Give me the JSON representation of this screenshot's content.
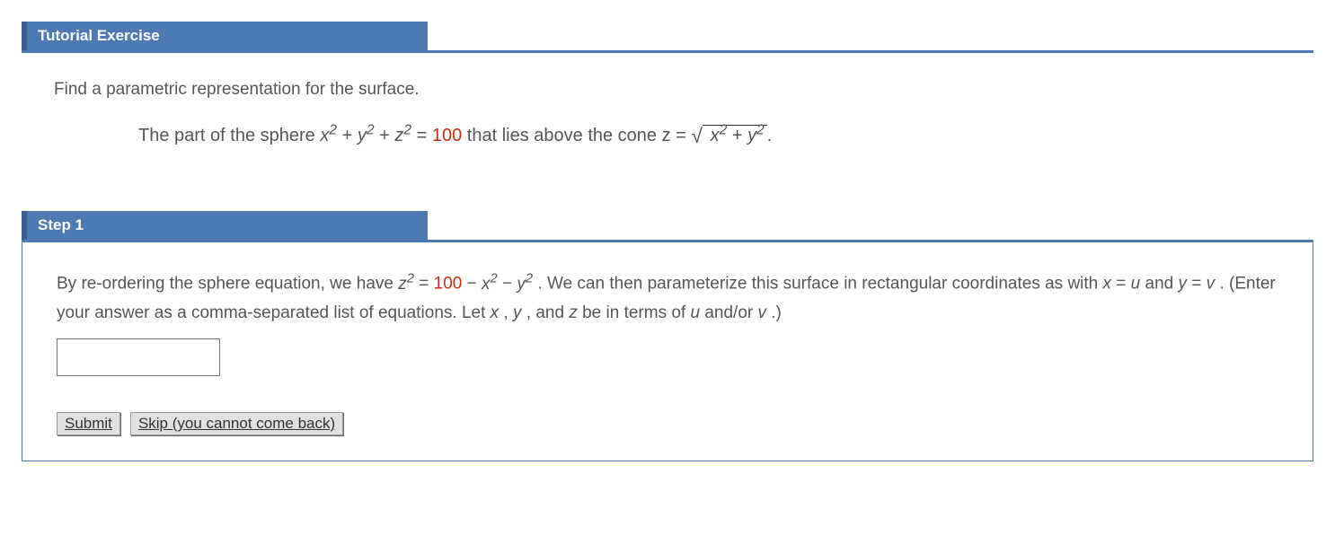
{
  "tutorial": {
    "header": "Tutorial Exercise",
    "intro": "Find a parametric representation for the surface.",
    "problem_prefix": "The part of the sphere ",
    "sphere_expr_a": "x",
    "sphere_expr_plus": " + ",
    "sphere_expr_b": "y",
    "sphere_expr_c": "z",
    "sphere_eq": " = ",
    "sphere_val": "100",
    "problem_mid": " that lies above the cone z = ",
    "sqrt_inner_a": "x",
    "sqrt_inner_plus": " + ",
    "sqrt_inner_b": "y",
    "problem_end": "."
  },
  "step1": {
    "header": "Step 1",
    "text1a": "By re-ordering the sphere equation, we have ",
    "z": "z",
    "eq": " = ",
    "val": "100",
    "minus": " − ",
    "x": "x",
    "y": "y",
    "text1b": ". We can then parameterize this surface in rectangular coordinates as with ",
    "xeq": "x",
    "equ": " = ",
    "u": "u",
    "andtxt": " and ",
    "yeq": "y",
    "v": "v",
    "text1c": ". (Enter your answer as a comma-separated list of equations. Let ",
    "letx": "x",
    "comma1": ", ",
    "lety": "y",
    "comma2": ", and ",
    "letz": "z",
    "text1d": " be in terms of ",
    "letu": "u",
    "andor": " and/or ",
    "letv": "v",
    "text1e": ".)",
    "answer_value": ""
  },
  "buttons": {
    "submit": "Submit",
    "skip": "Skip (you cannot come back)"
  }
}
